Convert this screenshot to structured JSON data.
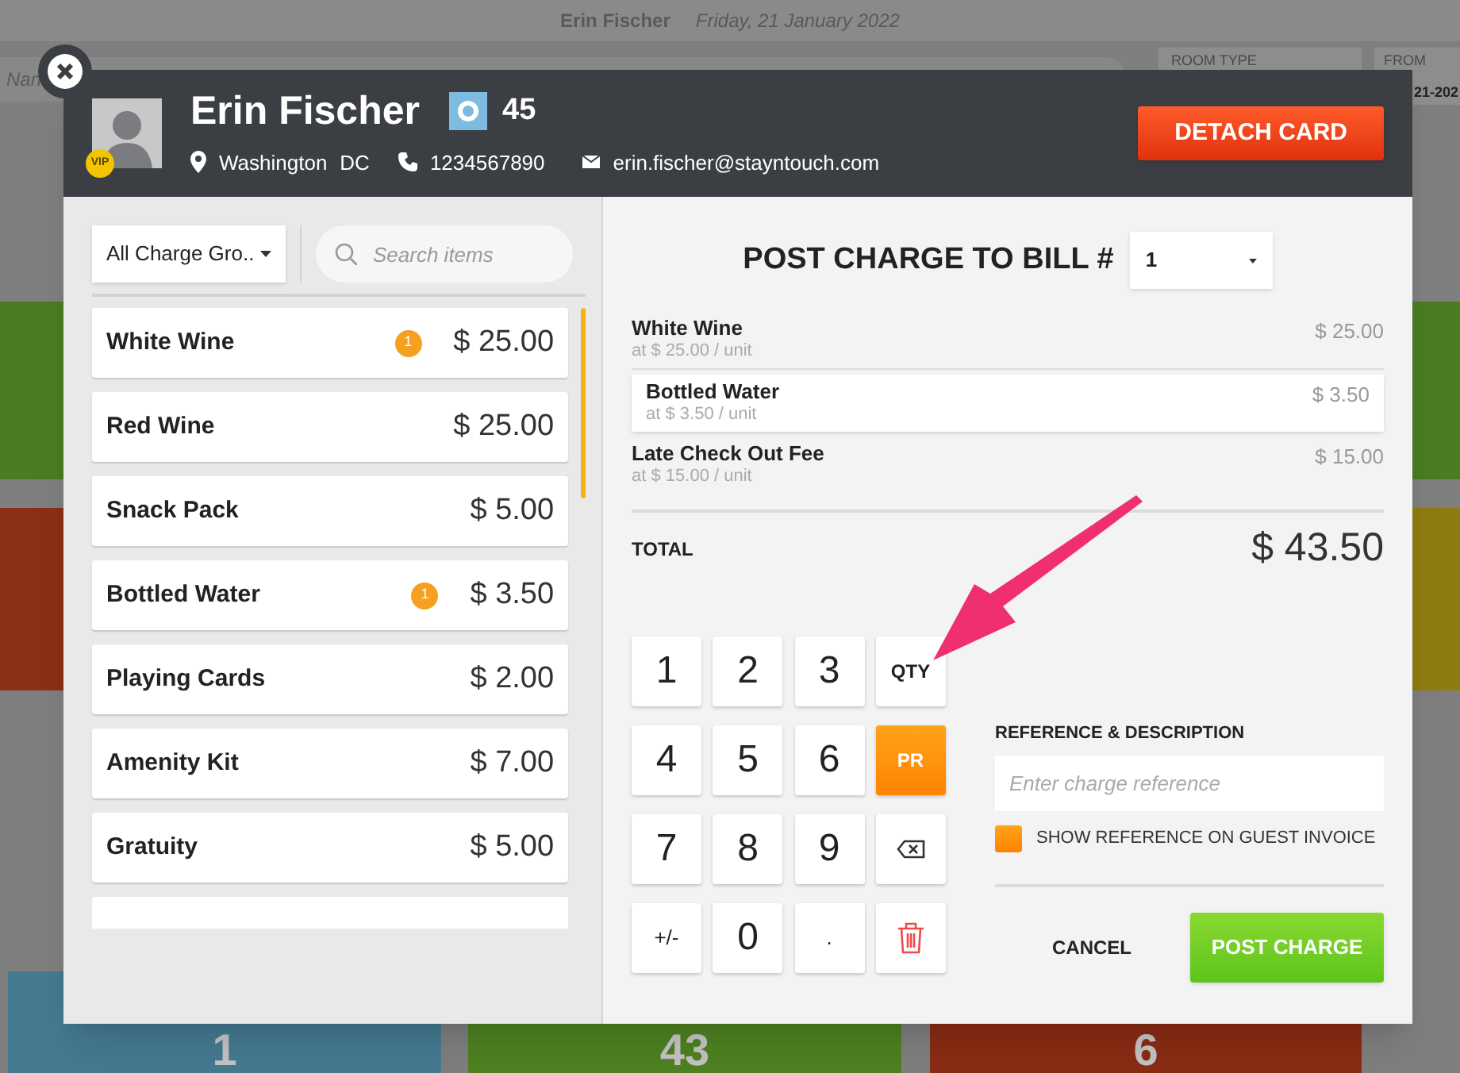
{
  "background": {
    "guest_name": "Erin Fischer",
    "date": "Friday, 21 January 2022",
    "field_hint": "Nan",
    "fields": [
      {
        "label": "ROOM TYPE"
      },
      {
        "label": "FROM",
        "value": "21-202"
      }
    ],
    "tiles": [
      {
        "label": "1",
        "color": "#457a91"
      },
      {
        "label": "43",
        "color": "#4e8221"
      },
      {
        "label": "6",
        "color": "#8a2c14"
      }
    ]
  },
  "guest": {
    "name": "Erin Fischer",
    "vip": "VIP",
    "room": "45",
    "city": "Washington",
    "state": "DC",
    "phone": "1234567890",
    "email": "erin.fischer@stayntouch.com"
  },
  "detach_button": "DETACH CARD",
  "group_filter": "All Charge Gro..",
  "search": {
    "placeholder": "Search items"
  },
  "items": [
    {
      "name": "White Wine",
      "price": "$ 25.00",
      "count": "1"
    },
    {
      "name": "Red Wine",
      "price": "$ 25.00"
    },
    {
      "name": "Snack Pack",
      "price": "$ 5.00"
    },
    {
      "name": "Bottled Water",
      "price": "$ 3.50",
      "count": "1"
    },
    {
      "name": "Playing Cards",
      "price": "$ 2.00"
    },
    {
      "name": "Amenity Kit",
      "price": "$ 7.00"
    },
    {
      "name": "Gratuity",
      "price": "$ 5.00"
    }
  ],
  "bill": {
    "title": "POST CHARGE TO BILL #",
    "number": "1"
  },
  "lines": [
    {
      "name": "White Wine",
      "unit": "at $ 25.00 / unit",
      "amount": "$ 25.00",
      "selected": false
    },
    {
      "name": "Bottled Water",
      "unit": "at $ 3.50 / unit",
      "amount": "$ 3.50",
      "selected": true
    },
    {
      "name": "Late Check Out Fee",
      "unit": "at $ 15.00 / unit",
      "amount": "$ 15.00",
      "selected": false
    }
  ],
  "total": {
    "label": "TOTAL",
    "amount": "$ 43.50"
  },
  "keypad": [
    {
      "kind": "digit",
      "label": "1"
    },
    {
      "kind": "digit",
      "label": "2"
    },
    {
      "kind": "digit",
      "label": "3"
    },
    {
      "kind": "action",
      "label": "QTY",
      "selected": false
    },
    {
      "kind": "digit",
      "label": "4"
    },
    {
      "kind": "digit",
      "label": "5"
    },
    {
      "kind": "digit",
      "label": "6"
    },
    {
      "kind": "action",
      "label": "PR",
      "selected": true
    },
    {
      "kind": "digit",
      "label": "7"
    },
    {
      "kind": "digit",
      "label": "8"
    },
    {
      "kind": "digit",
      "label": "9"
    },
    {
      "kind": "backspace"
    },
    {
      "kind": "small",
      "label": "+/-"
    },
    {
      "kind": "digit",
      "label": "0"
    },
    {
      "kind": "small",
      "label": "."
    },
    {
      "kind": "delete"
    }
  ],
  "reference": {
    "label": "REFERENCE & DESCRIPTION",
    "placeholder": "Enter charge reference",
    "checkbox": {
      "label": "SHOW REFERENCE ON GUEST INVOICE",
      "checked": true
    }
  },
  "cancel_button": "CANCEL",
  "post_button": "POST CHARGE"
}
